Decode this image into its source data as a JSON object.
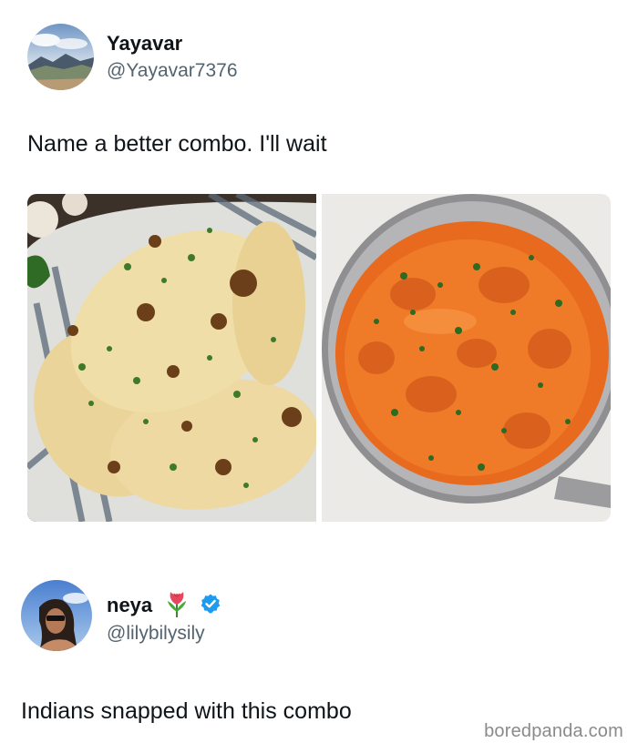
{
  "tweet1": {
    "display_name": "Yayavar",
    "handle": "@Yayavar7376",
    "text": "Name a better combo. I'll wait",
    "avatar_icon": "mountain-landscape-avatar",
    "images": [
      {
        "icon": "naan-bread-photo"
      },
      {
        "icon": "butter-chicken-curry-photo"
      }
    ]
  },
  "tweet2": {
    "display_name": "neya",
    "handle": "@lilybilysily",
    "text": "Indians snapped with this combo",
    "avatar_icon": "woman-profile-avatar",
    "emoji_icon": "tulip-icon",
    "verified_icon": "verified-badge-icon",
    "verified_color": "#1d9bf0"
  },
  "watermark": "boredpanda.com"
}
